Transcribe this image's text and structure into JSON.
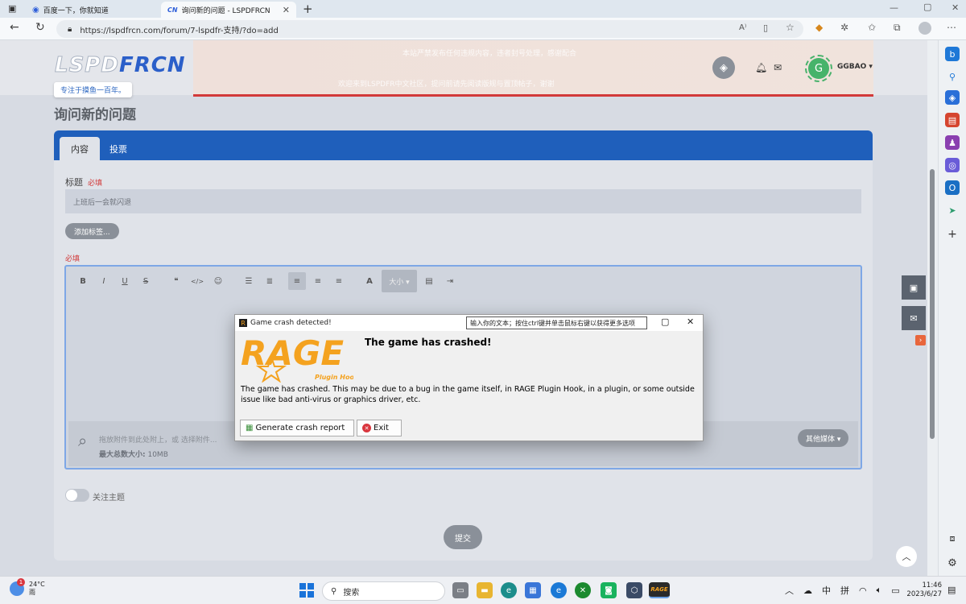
{
  "browser": {
    "tabs": [
      {
        "label": "百度一下，你就知道",
        "icon": "baidu-paw-icon"
      },
      {
        "label": "询问新的问题 - LSPDFRCN",
        "icon": "cn-site-icon"
      }
    ],
    "url": "https://lspdfrcn.com/forum/7-lspdfr-支持/?do=add",
    "new_tab": "+",
    "cn_badge": "CN"
  },
  "site": {
    "logo_left": "LSPD",
    "logo_right": "FRCN",
    "slogan": "专注于摸鱼一百年。",
    "username": "GGBAO ▾",
    "avatar_letter": "G",
    "banner_line1": "本站严禁发布任何违规内容，违者封号处理，感谢配合",
    "banner_line2": "欢迎来到LSPDFR中文社区，提问前请先阅读版规与置顶帖子，谢谢"
  },
  "form": {
    "page_title": "询问新的问题",
    "tabs": [
      "内容",
      "投票"
    ],
    "title_label": "标题",
    "required": "必填",
    "title_value": "上班后一会就闪退",
    "add_tag": "添加标签...",
    "body_required": "必填",
    "toolbar": {
      "bold": "B",
      "italic": "I",
      "underline": "U",
      "strike": "S",
      "quote": "❝",
      "code": "</>",
      "emoji": "☺",
      "font_size": "大小 ▾"
    },
    "attach_text": "拖放附件到此处附上，或 选择附件...",
    "attach_max_label": "最大总数大小:",
    "attach_max_value": "10MB",
    "other_media": "其他媒体 ▾",
    "follow_label": "关注主题",
    "submit": "提交"
  },
  "dialog": {
    "title": "Game crash detected!",
    "tooltip": "输入你的文本；按住ctrl键并单击鼠标右键以获得更多选项",
    "logo_text": "RAGE",
    "logo_sub": "Plugin Hook",
    "heading": "The game has crashed!",
    "message": "The game has crashed. This may be due to a bug in the game itself, in RAGE Plugin Hook, in a plugin, or some outside issue like bad anti-virus or graphics driver, etc.",
    "btn_report": "Generate crash report",
    "btn_exit": "Exit"
  },
  "taskbar": {
    "weather_temp": "24°C",
    "weather_cond": "雨",
    "weather_badge": "1",
    "search": "搜索",
    "tray_ime1": "中",
    "tray_ime2": "拼",
    "time": "11:46",
    "date": "2023/6/27"
  },
  "colors": {
    "brand_blue": "#1f5fbb",
    "banner_red": "#d23939",
    "rage_orange": "#f4a21f"
  }
}
